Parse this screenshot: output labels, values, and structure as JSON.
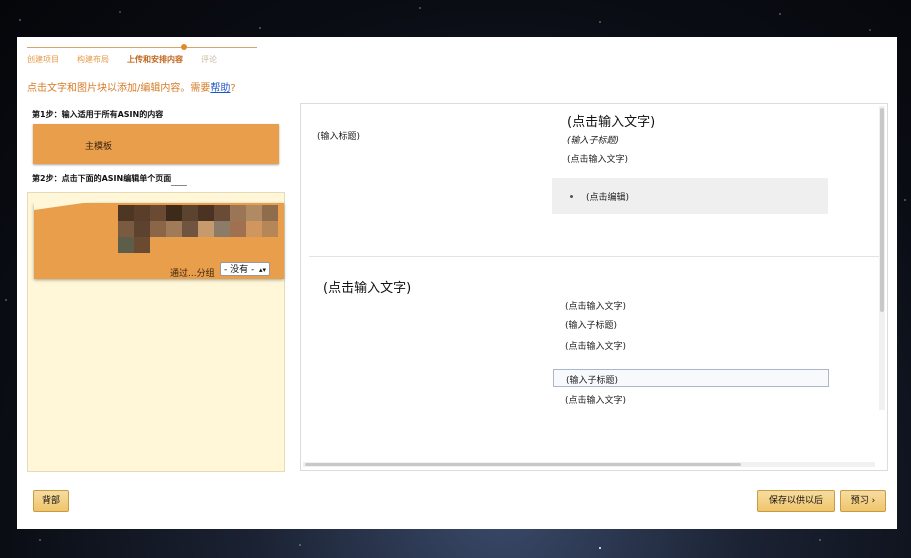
{
  "steps": [
    {
      "label": "创建项目",
      "state": "done"
    },
    {
      "label": "构建布局",
      "state": "done"
    },
    {
      "label": "上传和安排内容",
      "state": "active"
    },
    {
      "label": "评论",
      "state": "upcoming"
    }
  ],
  "help": {
    "text": "点击文字和图片块以添加/编辑内容。需要",
    "link": "帮助",
    "suffix": "?"
  },
  "left": {
    "step1_label": "第1步：输入适用于所有ASIN的内容",
    "master_template": "主模板",
    "step2_label": "第2步：点击下面的ASIN编辑单个页面",
    "group_label": "通过...分组",
    "group_select_value": "- 没有 -"
  },
  "preview": {
    "module1": {
      "heading_label": "(输入标题)",
      "title": "(点击输入文字)",
      "subtitle": "(输入子标题)",
      "body": "(点击输入文字)",
      "bullet": "(点击编辑)"
    },
    "module2": {
      "title": "(点击输入文字)",
      "body1": "(点击输入文字)",
      "subtitle1": "(输入子标题)",
      "body2": "(点击输入文字)",
      "subtitle2": "(输入子标题)",
      "body3": "(点击输入文字)"
    }
  },
  "footer": {
    "back": "背部",
    "save": "保存以供以后",
    "preview": "预习 ›"
  },
  "colors": {
    "accent": "#e99e4b",
    "step_active": "#c1661a",
    "link": "#1f56c6",
    "list_bg": "#fff7d8"
  }
}
